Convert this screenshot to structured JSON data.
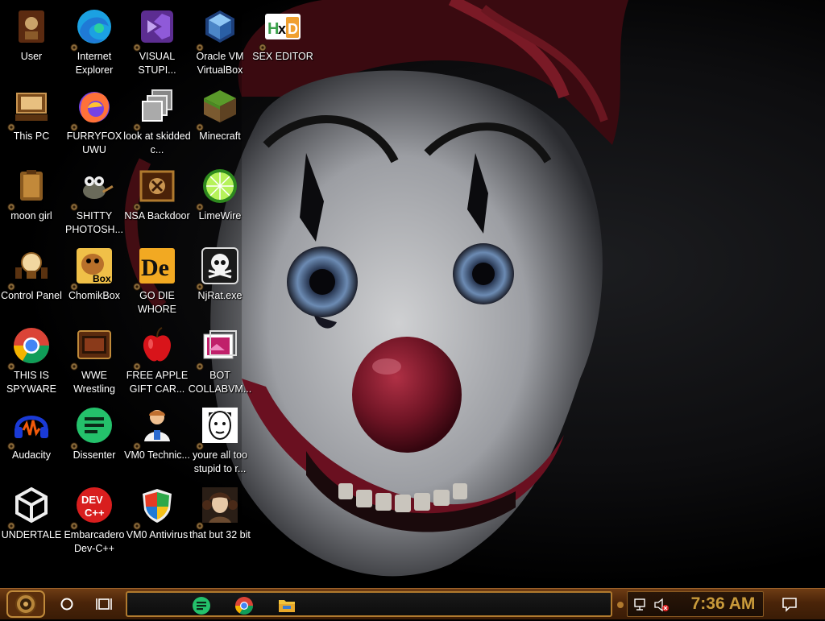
{
  "desktop": {
    "icons": [
      {
        "id": "user",
        "label": "User",
        "icon": "steampunk-user-icon"
      },
      {
        "id": "internet-explorer",
        "label": "Internet Explorer",
        "icon": "edge-logo-icon"
      },
      {
        "id": "visual-studio",
        "label": "VISUAL STUPI...",
        "icon": "visual-studio-icon"
      },
      {
        "id": "virtualbox",
        "label": "Oracle VM VirtualBox",
        "icon": "virtualbox-cube-icon"
      },
      {
        "id": "hxd",
        "label": "SEX EDITOR",
        "icon": "hxd-hex-editor-icon"
      },
      {
        "id": "this-pc",
        "label": "This PC",
        "icon": "steampunk-computer-icon"
      },
      {
        "id": "firefox",
        "label": "FURRYFOX UWU",
        "icon": "firefox-icon"
      },
      {
        "id": "skidded",
        "label": "look at skidded c...",
        "icon": "stacked-windows-icon"
      },
      {
        "id": "minecraft",
        "label": "Minecraft",
        "icon": "minecraft-grass-block-icon"
      },
      {
        "id": "moon-girl",
        "label": "moon girl",
        "icon": "steampunk-folder-icon"
      },
      {
        "id": "gimp",
        "label": "SHITTY PHOTOSH...",
        "icon": "gimp-mascot-icon"
      },
      {
        "id": "nsa",
        "label": "NSA Backdoor",
        "icon": "steampunk-panel-icon"
      },
      {
        "id": "limewire",
        "label": "LimeWire",
        "icon": "limewire-lime-icon"
      },
      {
        "id": "control-panel",
        "label": "Control Panel",
        "icon": "steampunk-lightbulb-icon"
      },
      {
        "id": "chomikbox",
        "label": "ChomikBox",
        "icon": "chomikbox-hamster-icon"
      },
      {
        "id": "go-die",
        "label": "GO DIE WHORE",
        "icon": "delphi-de-icon"
      },
      {
        "id": "njrat",
        "label": "NjRat.exe",
        "icon": "skull-icon"
      },
      {
        "id": "chrome",
        "label": "THIS IS SPYWARE",
        "icon": "chrome-logo-icon"
      },
      {
        "id": "wwe",
        "label": "WWE Wrestling",
        "icon": "steampunk-tv-icon"
      },
      {
        "id": "apple",
        "label": "FREE APPLE GIFT CAR...",
        "icon": "red-apple-icon"
      },
      {
        "id": "bot",
        "label": "BOT COLLABVM...",
        "icon": "film-frames-icon"
      },
      {
        "id": "audacity",
        "label": "Audacity",
        "icon": "audacity-headphones-icon"
      },
      {
        "id": "dissenter",
        "label": "Dissenter",
        "icon": "dissenter-green-bubble-icon"
      },
      {
        "id": "vm0-tech",
        "label": "VM0 Technic...",
        "icon": "technician-person-icon"
      },
      {
        "id": "stupid",
        "label": "youre all too stupid to r...",
        "icon": "face-portrait-icon"
      },
      {
        "id": "undertale",
        "label": "UNDERTALE",
        "icon": "unity-logo-icon"
      },
      {
        "id": "devcpp",
        "label": "Embarcadero Dev-C++",
        "icon": "devcpp-logo-icon"
      },
      {
        "id": "vm0-antivirus",
        "label": "VM0 Antivirus",
        "icon": "windows-shield-icon"
      },
      {
        "id": "32bit",
        "label": "that but 32 bit",
        "icon": "woman-portrait-icon"
      }
    ]
  },
  "taskbar": {
    "start_icon": "steampunk-gear-start-icon",
    "search_icon": "circle-search-icon",
    "task_view_icon": "task-view-icon",
    "pinned": [
      {
        "name": "dissenter",
        "icon": "dissenter-green-bubble-icon"
      },
      {
        "name": "chrome",
        "icon": "chrome-logo-icon"
      },
      {
        "name": "file-explorer",
        "icon": "folder-icon"
      }
    ],
    "tray_icons": [
      "chevron-up-icon",
      "network-icon",
      "speaker-muted-icon"
    ],
    "clock": "7:36 AM",
    "action_center_icon": "notification-icon"
  },
  "colors": {
    "taskbar_brown": "#4a2409",
    "accent_brass": "#b07a2e",
    "clock": "#c89a3a"
  }
}
